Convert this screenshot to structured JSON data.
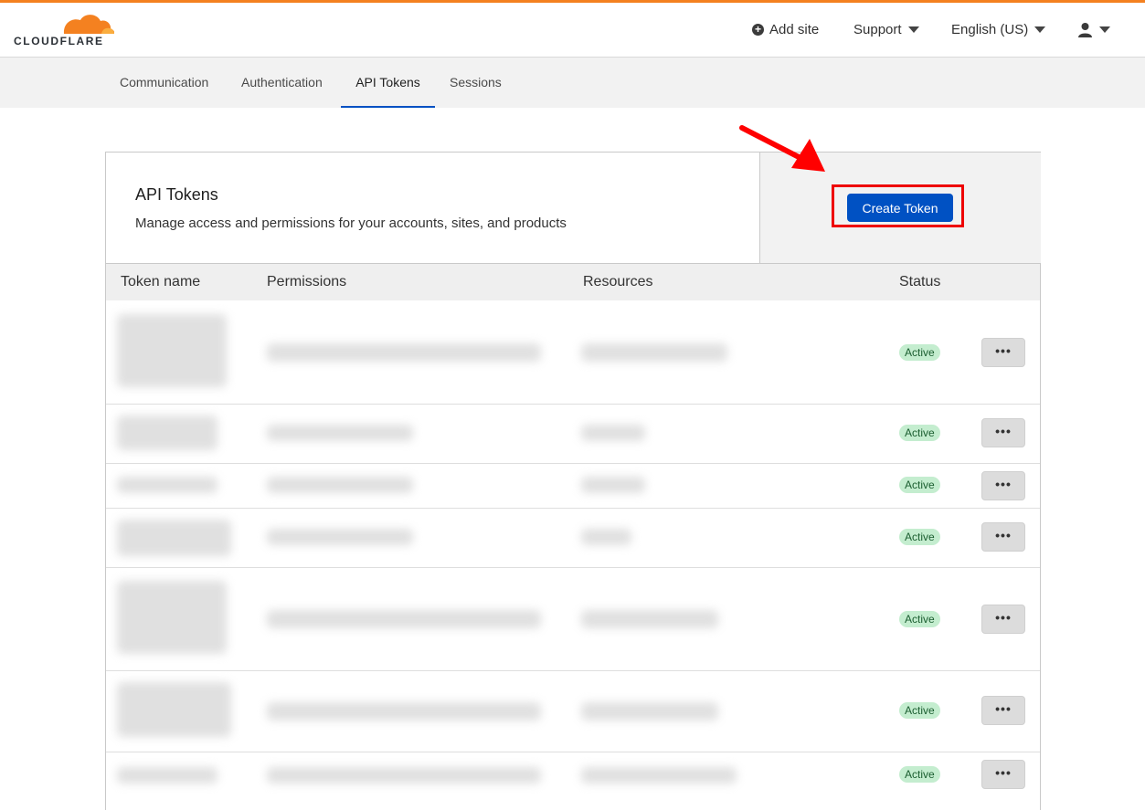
{
  "brand": {
    "name": "CLOUDFLARE",
    "accent_color": "#f48120"
  },
  "header": {
    "add_site_label": "Add site",
    "support_label": "Support",
    "language_label": "English (US)",
    "user_icon": "user-icon"
  },
  "tabs": [
    {
      "label": "Communication"
    },
    {
      "label": "Authentication"
    },
    {
      "label": "API Tokens",
      "active": true
    },
    {
      "label": "Sessions"
    }
  ],
  "card": {
    "title": "API Tokens",
    "subtitle": "Manage access and permissions for your accounts, sites, and products",
    "create_button_label": "Create Token",
    "primary_color": "#0051c3",
    "highlight_color": "#ee0000"
  },
  "table": {
    "columns": [
      "Token name",
      "Permissions",
      "Resources",
      "Status"
    ],
    "rows": [
      {
        "status": "Active",
        "menu": "•••"
      },
      {
        "status": "Active",
        "menu": "•••"
      },
      {
        "status": "Active",
        "menu": "•••"
      },
      {
        "status": "Active",
        "menu": "•••"
      },
      {
        "status": "Active",
        "menu": "•••"
      },
      {
        "status": "Active",
        "menu": "•••"
      },
      {
        "status": "Active",
        "menu": "•••"
      }
    ]
  }
}
